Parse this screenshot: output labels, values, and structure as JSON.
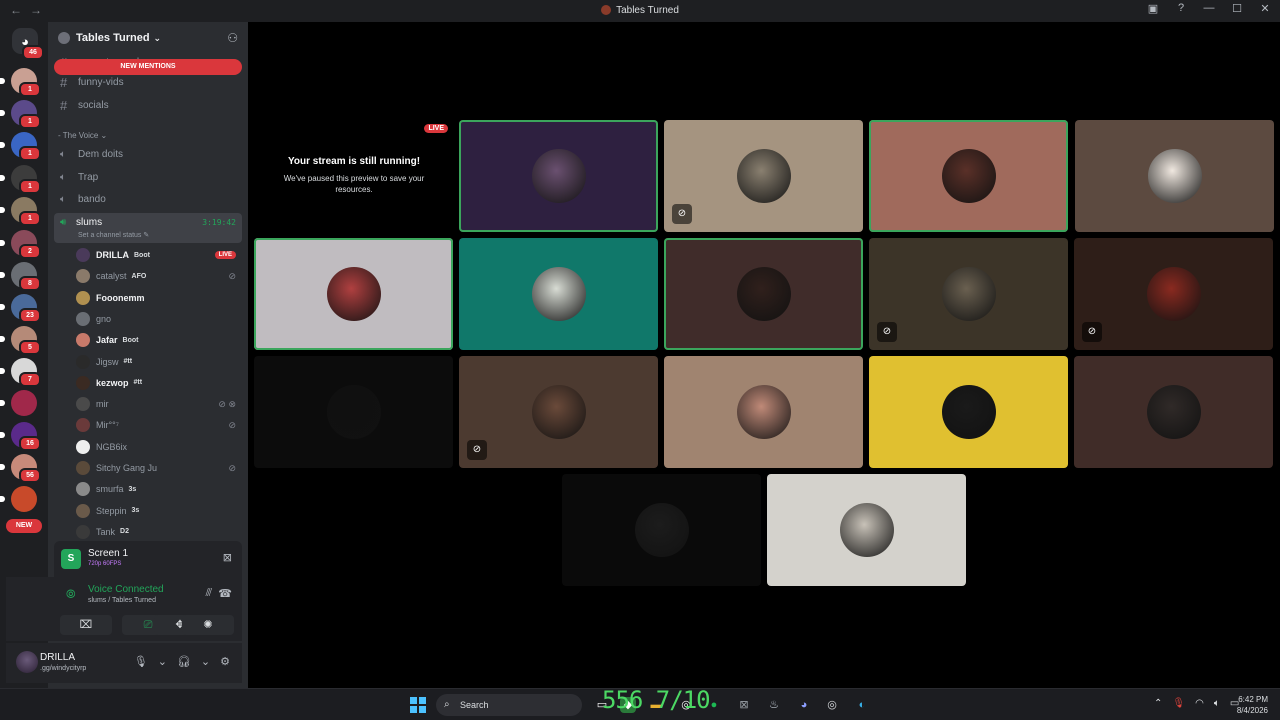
{
  "window": {
    "title": "Tables Turned"
  },
  "rail": {
    "home_badge": "46",
    "servers": [
      {
        "badge": "1",
        "color": "#c9a093"
      },
      {
        "badge": "1",
        "color": "#5b4a8a"
      },
      {
        "badge": "1",
        "color": "#3a66c4"
      },
      {
        "badge": "1",
        "color": "#3c3c3c"
      },
      {
        "badge": "1",
        "color": "#8a7a62"
      },
      {
        "badge": "2",
        "color": "#8a4a5a"
      },
      {
        "badge": "8",
        "color": "#6a6e74"
      },
      {
        "badge": "23",
        "color": "#4a6a9a"
      },
      {
        "badge": "5",
        "color": "#b58a78"
      },
      {
        "badge": "7",
        "color": "#d8d8d8"
      },
      {
        "badge": "",
        "color": "#a0284a"
      },
      {
        "badge": "16",
        "color": "#5a2a8a"
      },
      {
        "badge": "56",
        "color": "#c78a7a"
      },
      {
        "badge": "",
        "color": "#c84a2a"
      }
    ],
    "new_label": "NEW"
  },
  "guild": {
    "name": "Tables Turned",
    "new_mentions": "NEW MENTIONS",
    "text_channels": [
      "promote-ya-sh",
      "funny-vids",
      "socials"
    ],
    "category": "The Voice",
    "voice_channels": [
      "Dem doits",
      "Trap",
      "bando"
    ],
    "active_channel": {
      "name": "slums",
      "timer": "3:19:42",
      "status": "Set a channel status"
    },
    "members": [
      {
        "name": "DRILLA",
        "tag": "Boot",
        "bold": true,
        "right": "LIVE",
        "color": "#4a3a5a"
      },
      {
        "name": "catalyst",
        "tag": "AFO",
        "bold": false,
        "right": "mic-off",
        "color": "#8a7a6a"
      },
      {
        "name": "Fooonemm",
        "tag": "",
        "bold": true,
        "right": "",
        "color": "#b09050"
      },
      {
        "name": "gno",
        "tag": "",
        "bold": false,
        "right": "",
        "color": "#6a6e74"
      },
      {
        "name": "Jafar",
        "tag": "Boot",
        "bold": true,
        "right": "",
        "color": "#c87a6a"
      },
      {
        "name": "Jigsw",
        "tag": "#tt",
        "bold": false,
        "right": "",
        "color": "#2a2a2a"
      },
      {
        "name": "kezwop",
        "tag": "#tt",
        "bold": true,
        "right": "",
        "color": "#3a2a22"
      },
      {
        "name": "mir",
        "tag": "",
        "bold": false,
        "right": "mic-off deaf",
        "color": "#4a4a4a"
      },
      {
        "name": "Mir°°⁷",
        "tag": "",
        "bold": false,
        "right": "mic-off",
        "color": "#6a3a3a"
      },
      {
        "name": "NGB6ix",
        "tag": "",
        "bold": false,
        "right": "",
        "color": "#eeeeee"
      },
      {
        "name": "Sitchy Gang Ju",
        "tag": "",
        "bold": false,
        "right": "mic-off",
        "color": "#5a4a3a"
      },
      {
        "name": "smurfa",
        "tag": "3s",
        "bold": false,
        "right": "",
        "color": "#8a8a8a"
      },
      {
        "name": "Steppin",
        "tag": "3s",
        "bold": false,
        "right": "",
        "color": "#6a5a4a"
      },
      {
        "name": "Tank",
        "tag": "D2",
        "bold": false,
        "right": "",
        "color": "#3a3a3a"
      }
    ]
  },
  "stream": {
    "name": "Screen 1",
    "quality": "720p 60FPS"
  },
  "voice": {
    "title": "Voice Connected",
    "subtitle": "slums / Tables Turned"
  },
  "user": {
    "name": "DRILLA",
    "status": ".gg/windycityrp"
  },
  "stage": {
    "live_label": "LIVE",
    "paused_title": "Your stream is still running!",
    "paused_sub": "We've paused this preview to save your resources.",
    "tiles": [
      {
        "bg": "#2e2040",
        "av": "#6a5070",
        "speaking": true,
        "mute": false
      },
      {
        "bg": "#a59480",
        "av": "#8a8070",
        "speaking": false,
        "mute": true
      },
      {
        "bg": "#a06a5c",
        "av": "#5a3028",
        "speaking": true,
        "mute": false
      },
      {
        "bg": "#5c4a40",
        "av": "#f0e8e0",
        "speaking": false,
        "mute": false
      },
      {
        "bg": "#c0bcc0",
        "av": "#b04040",
        "speaking": true,
        "mute": false
      },
      {
        "bg": "#10786a",
        "av": "#d8dcd4",
        "speaking": false,
        "mute": false
      },
      {
        "bg": "#402c2a",
        "av": "#30201c",
        "speaking": true,
        "mute": false
      },
      {
        "bg": "#3c3428",
        "av": "#6a6050",
        "speaking": false,
        "mute": true
      },
      {
        "bg": "#2e1e18",
        "av": "#8a2a20",
        "speaking": false,
        "mute": true
      },
      {
        "bg": "#0c0c0c",
        "av": "#101010",
        "speaking": false,
        "mute": false
      },
      {
        "bg": "#4c3a30",
        "av": "#6a4a3a",
        "speaking": false,
        "mute": true
      },
      {
        "bg": "#a08470",
        "av": "#c08a78",
        "speaking": false,
        "mute": false
      },
      {
        "bg": "#e0c030",
        "av": "#1a1a1a",
        "speaking": false,
        "mute": false
      },
      {
        "bg": "#402c28",
        "av": "#302a28",
        "speaking": false,
        "mute": false
      },
      {
        "bg": "#0a0a0a",
        "av": "#1c1c1c",
        "speaking": false,
        "mute": false
      },
      {
        "bg": "#d4d2cc",
        "av": "#c8c2b8",
        "speaking": false,
        "mute": false
      }
    ]
  },
  "taskbar": {
    "search_placeholder": "Search",
    "time": "6:42 PM",
    "date": "8/4/2026",
    "overlay_counter": "556 7/10"
  }
}
